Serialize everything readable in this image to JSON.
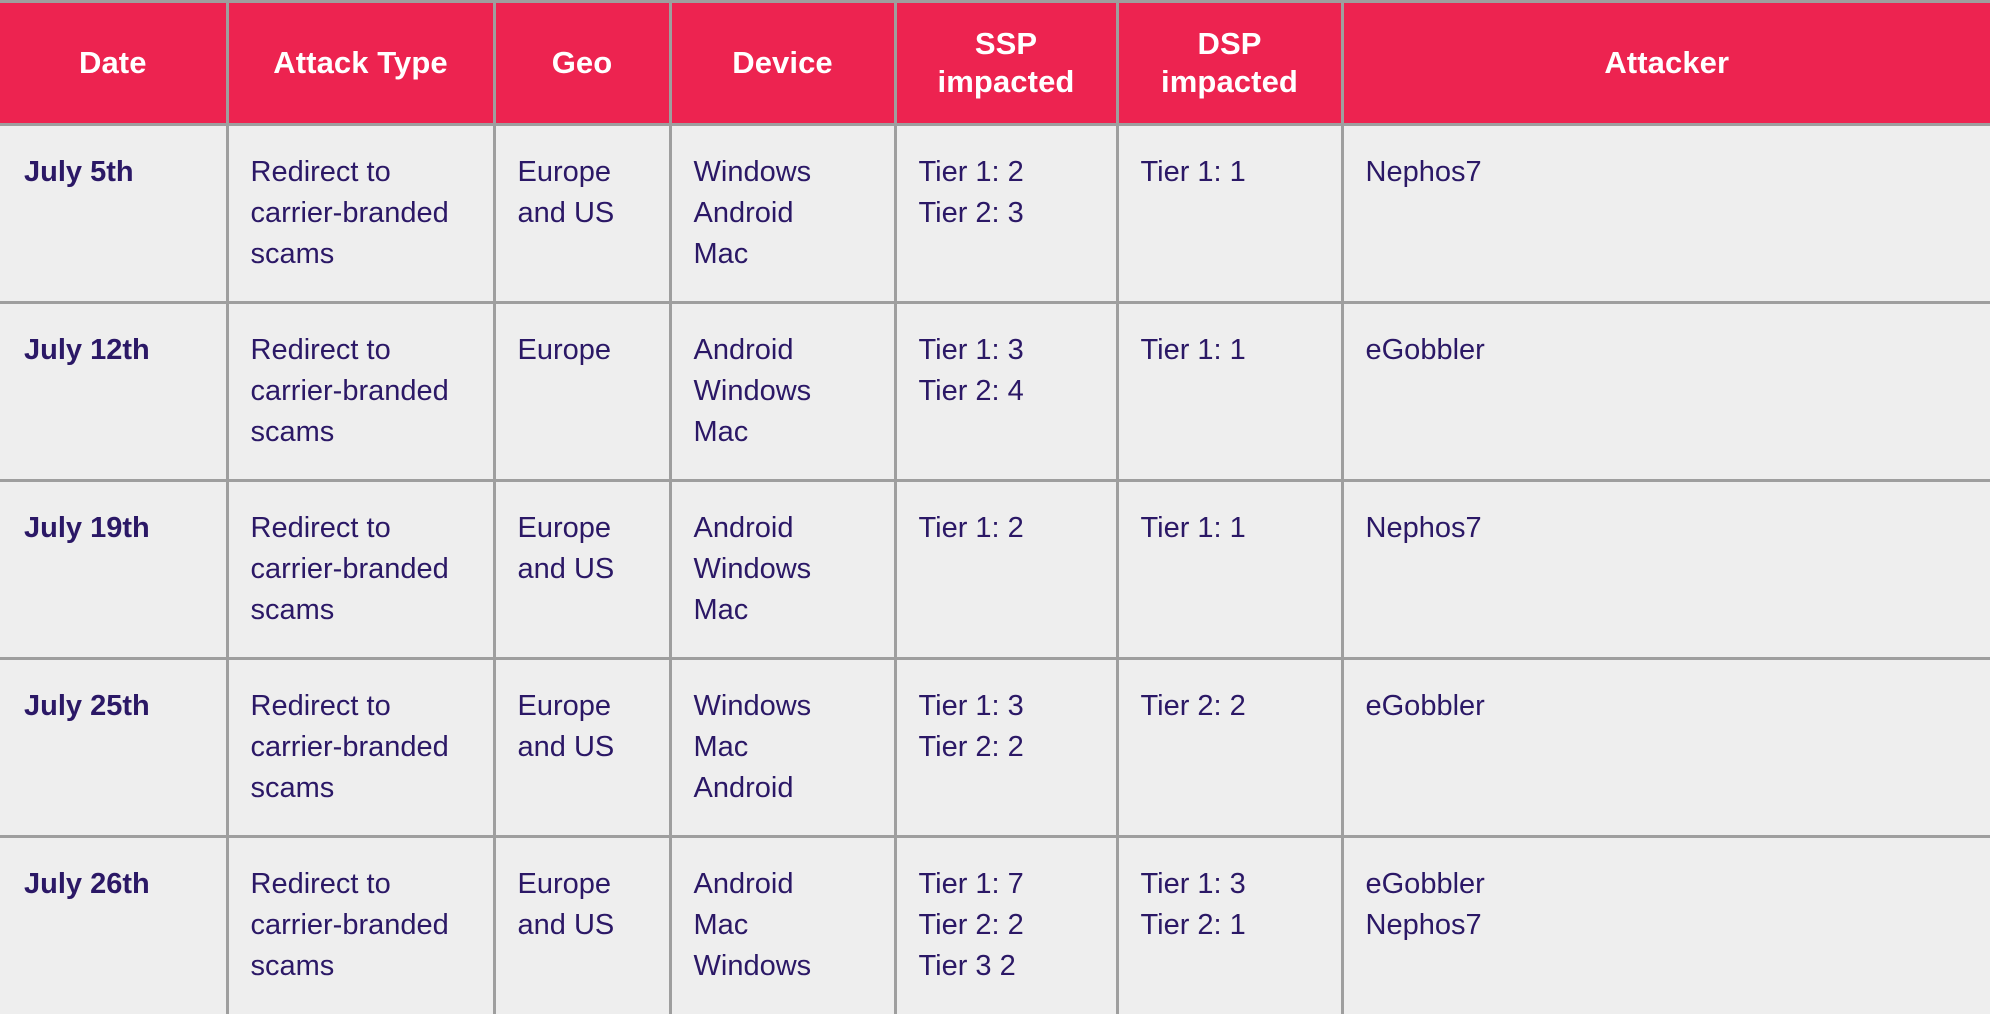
{
  "table": {
    "columns": [
      {
        "key": "date",
        "label": "Date"
      },
      {
        "key": "attack",
        "label": "Attack Type"
      },
      {
        "key": "geo",
        "label": "Geo"
      },
      {
        "key": "device",
        "label": "Device"
      },
      {
        "key": "ssp",
        "label": "SSP\nimpacted"
      },
      {
        "key": "dsp",
        "label": "DSP\nimpacted"
      },
      {
        "key": "attacker",
        "label": "Attacker"
      }
    ],
    "rows": [
      {
        "date": "July 5th",
        "attack": "Redirect to\ncarrier-branded\nscams",
        "geo": "Europe\nand US",
        "device": "Windows\nAndroid\nMac",
        "ssp": "Tier 1: 2\nTier 2: 3",
        "dsp": "Tier 1: 1",
        "attacker": "Nephos7"
      },
      {
        "date": "July 12th",
        "attack": "Redirect to\ncarrier-branded\nscams",
        "geo": "Europe",
        "device": "Android\nWindows\nMac",
        "ssp": "Tier 1: 3\nTier 2: 4",
        "dsp": "Tier 1: 1",
        "attacker": "eGobbler"
      },
      {
        "date": "July 19th",
        "attack": "Redirect to\ncarrier-branded\nscams",
        "geo": "Europe\nand US",
        "device": "Android\nWindows\nMac",
        "ssp": "Tier 1: 2",
        "dsp": "Tier 1: 1",
        "attacker": "Nephos7"
      },
      {
        "date": "July 25th",
        "attack": "Redirect to\ncarrier-branded\nscams",
        "geo": "Europe\nand US",
        "device": "Windows\nMac\nAndroid",
        "ssp": "Tier 1: 3\nTier 2: 2",
        "dsp": "Tier 2: 2",
        "attacker": "eGobbler"
      },
      {
        "date": "July 26th",
        "attack": "Redirect to\ncarrier-branded\nscams",
        "geo": "Europe\nand US",
        "device": "Android\nMac\nWindows",
        "ssp": "Tier 1: 7\nTier 2: 2\nTier 3 2",
        "dsp": "Tier 1: 3\nTier 2: 1",
        "attacker": "eGobbler\nNephos7"
      }
    ]
  },
  "colors": {
    "header_background": "#ED2350",
    "header_text": "#FFFFFF",
    "body_background": "#EEEEEE",
    "body_text": "#2B1866",
    "border": "#9E9E9E"
  }
}
